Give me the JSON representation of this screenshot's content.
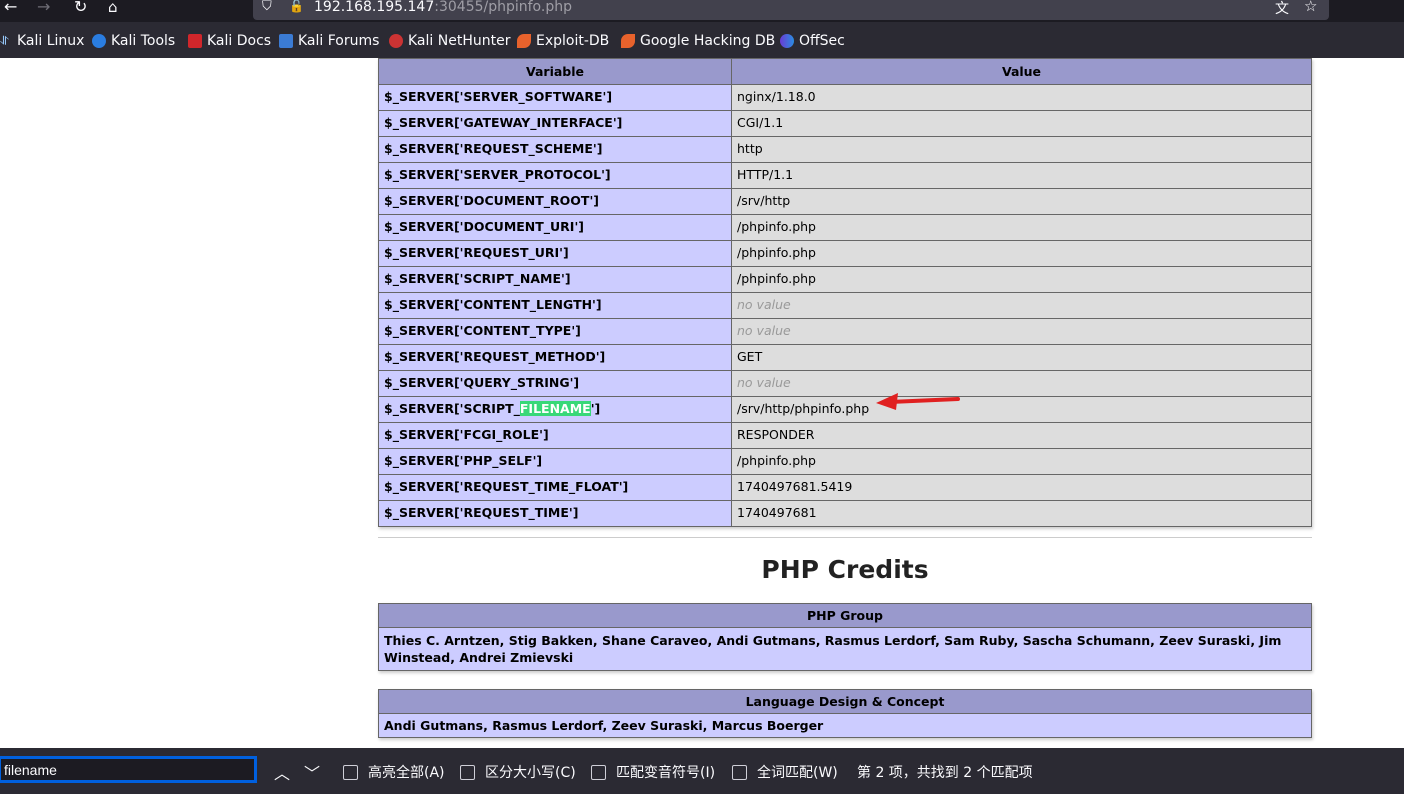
{
  "browser": {
    "url_host": "192.168.195.147",
    "url_rest": ":30455/phpinfo.php",
    "bookmarks": [
      "Kali Linux",
      "Kali Tools",
      "Kali Docs",
      "Kali Forums",
      "Kali NetHunter",
      "Exploit-DB",
      "Google Hacking DB",
      "OffSec"
    ]
  },
  "server_table": {
    "headers": [
      "Variable",
      "Value"
    ],
    "rows": [
      {
        "var": "$_SERVER['SERVER_SOFTWARE']",
        "val": "nginx/1.18.0"
      },
      {
        "var": "$_SERVER['GATEWAY_INTERFACE']",
        "val": "CGI/1.1"
      },
      {
        "var": "$_SERVER['REQUEST_SCHEME']",
        "val": "http"
      },
      {
        "var": "$_SERVER['SERVER_PROTOCOL']",
        "val": "HTTP/1.1"
      },
      {
        "var": "$_SERVER['DOCUMENT_ROOT']",
        "val": "/srv/http"
      },
      {
        "var": "$_SERVER['DOCUMENT_URI']",
        "val": "/phpinfo.php"
      },
      {
        "var": "$_SERVER['REQUEST_URI']",
        "val": "/phpinfo.php"
      },
      {
        "var": "$_SERVER['SCRIPT_NAME']",
        "val": "/phpinfo.php"
      },
      {
        "var": "$_SERVER['CONTENT_LENGTH']",
        "val": "no value"
      },
      {
        "var": "$_SERVER['CONTENT_TYPE']",
        "val": "no value"
      },
      {
        "var": "$_SERVER['REQUEST_METHOD']",
        "val": "GET"
      },
      {
        "var": "$_SERVER['QUERY_STRING']",
        "val": "no value"
      },
      {
        "var": "$_SERVER['SCRIPT_FILENAME']",
        "val": "/srv/http/phpinfo.php"
      },
      {
        "var": "$_SERVER['FCGI_ROLE']",
        "val": "RESPONDER"
      },
      {
        "var": "$_SERVER['PHP_SELF']",
        "val": "/phpinfo.php"
      },
      {
        "var": "$_SERVER['REQUEST_TIME_FLOAT']",
        "val": "1740497681.5419"
      },
      {
        "var": "$_SERVER['REQUEST_TIME']",
        "val": "1740497681"
      }
    ],
    "highlight_prefix": "$_SERVER['SCRIPT_",
    "highlight_match": "FILENAME",
    "highlight_suffix": "']"
  },
  "credits": {
    "title": "PHP Credits",
    "group_header": "PHP Group",
    "group_names": "Thies C. Arntzen, Stig Bakken, Shane Caraveo, Andi Gutmans, Rasmus Lerdorf, Sam Ruby, Sascha Schumann, Zeev Suraski, Jim Winstead, Andrei Zmievski",
    "design_header": "Language Design & Concept",
    "design_names": "Andi Gutmans, Rasmus Lerdorf, Zeev Suraski, Marcus Boerger"
  },
  "findbar": {
    "query": "filename",
    "highlight_all": "高亮全部(A)",
    "match_case": "区分大小写(C)",
    "match_diacritics": "匹配变音符号(I)",
    "whole_words": "全词匹配(W)",
    "status": "第 2 项，共找到 2 个匹配项"
  },
  "colors": {
    "row_label_bg": "#ccccff",
    "value_bg": "#dddddd",
    "header_bg": "#9999cc",
    "match_highlight": "#38d878",
    "arrow": "#e02020"
  }
}
